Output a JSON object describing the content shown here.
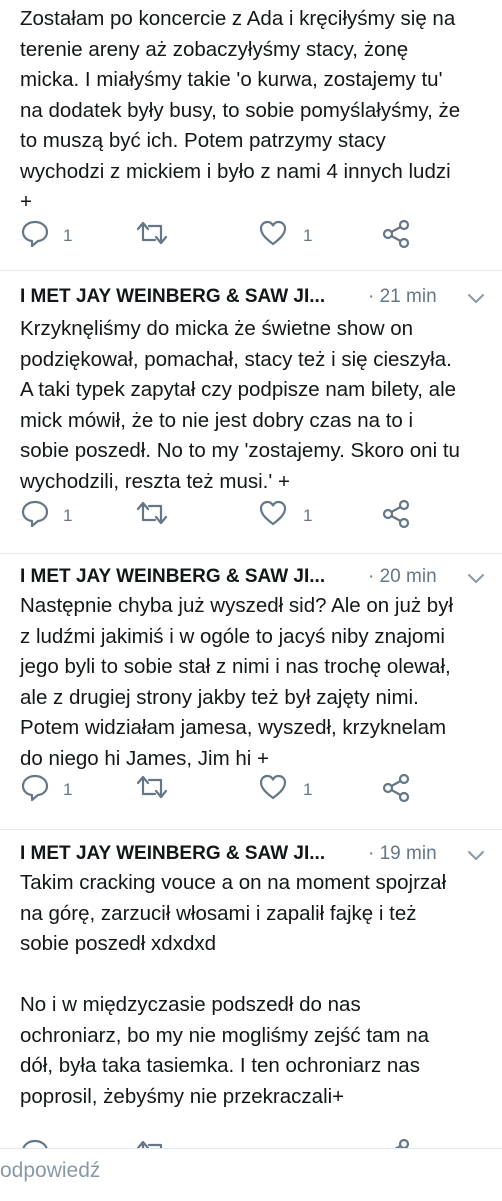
{
  "tweets": [
    {
      "author": "",
      "time": "",
      "text": "Zostałam po koncercie z Ada i kręciłyśmy się na\nterenie areny aż zobaczyłyśmy stacy, żonę\nmicka. I miałyśmy takie 'o kurwa, zostajemy tu'\nna dodatek były busy, to sobie pomyślałyśmy, że\nto muszą być ich. Potem patrzymy stacy\nwychodzi z mickiem i było z nami 4 innych ludzi\n+",
      "reply_count": "1",
      "like_count": "1"
    },
    {
      "author": "I MET JAY WEINBERG & SAW JI...",
      "time": "· 21 min",
      "text": "Krzyknęliśmy do micka że świetne show on\npodziękował, pomachał, stacy też i się cieszyła.\nA taki typek zapytał czy podpisze nam bilety, ale\nmick mówił, że to nie jest dobry czas na to i\nsobie poszedł. No to my 'zostajemy. Skoro oni tu\nwychodzili, reszta też musi.' +",
      "reply_count": "1",
      "like_count": "1"
    },
    {
      "author": "I MET JAY WEINBERG & SAW JI...",
      "time": "· 20 min",
      "text": "Następnie chyba już wyszedł sid? Ale on już był\nz ludźmi jakimiś i w ogóle to jacyś niby znajomi\njego byli to sobie stał z nimi i nas trochę olewał,\nale z drugiej strony jakby też był zajęty nimi.\nPotem widziałam jamesa, wyszedł, krzyknelam\ndo niego hi James, Jim hi +",
      "reply_count": "1",
      "like_count": "1"
    },
    {
      "author": "I MET JAY WEINBERG & SAW JI...",
      "time": "· 19 min",
      "text": "Takim cracking vouce a on na moment spojrzał\nna górę, zarzucił włosami i zapalił fajkę i też\nsobie poszedł xdxdxd\n\nNo i w międzyczasie podszedł do nas\nochroniarz, bo my nie mogliśmy zejść tam na\ndół, była taka tasiemka. I ten ochroniarz nas\npoprosil, żebyśmy nie przekraczali+",
      "reply_count": "",
      "like_count": ""
    }
  ],
  "reply_bar": {
    "placeholder": "odpowiedź"
  },
  "colors": {
    "text": "#14171a",
    "muted": "#657786",
    "divider": "#e1e8ed"
  },
  "icons": [
    "reply-icon",
    "retweet-icon",
    "like-icon",
    "share-icon",
    "chevron-down-icon"
  ]
}
